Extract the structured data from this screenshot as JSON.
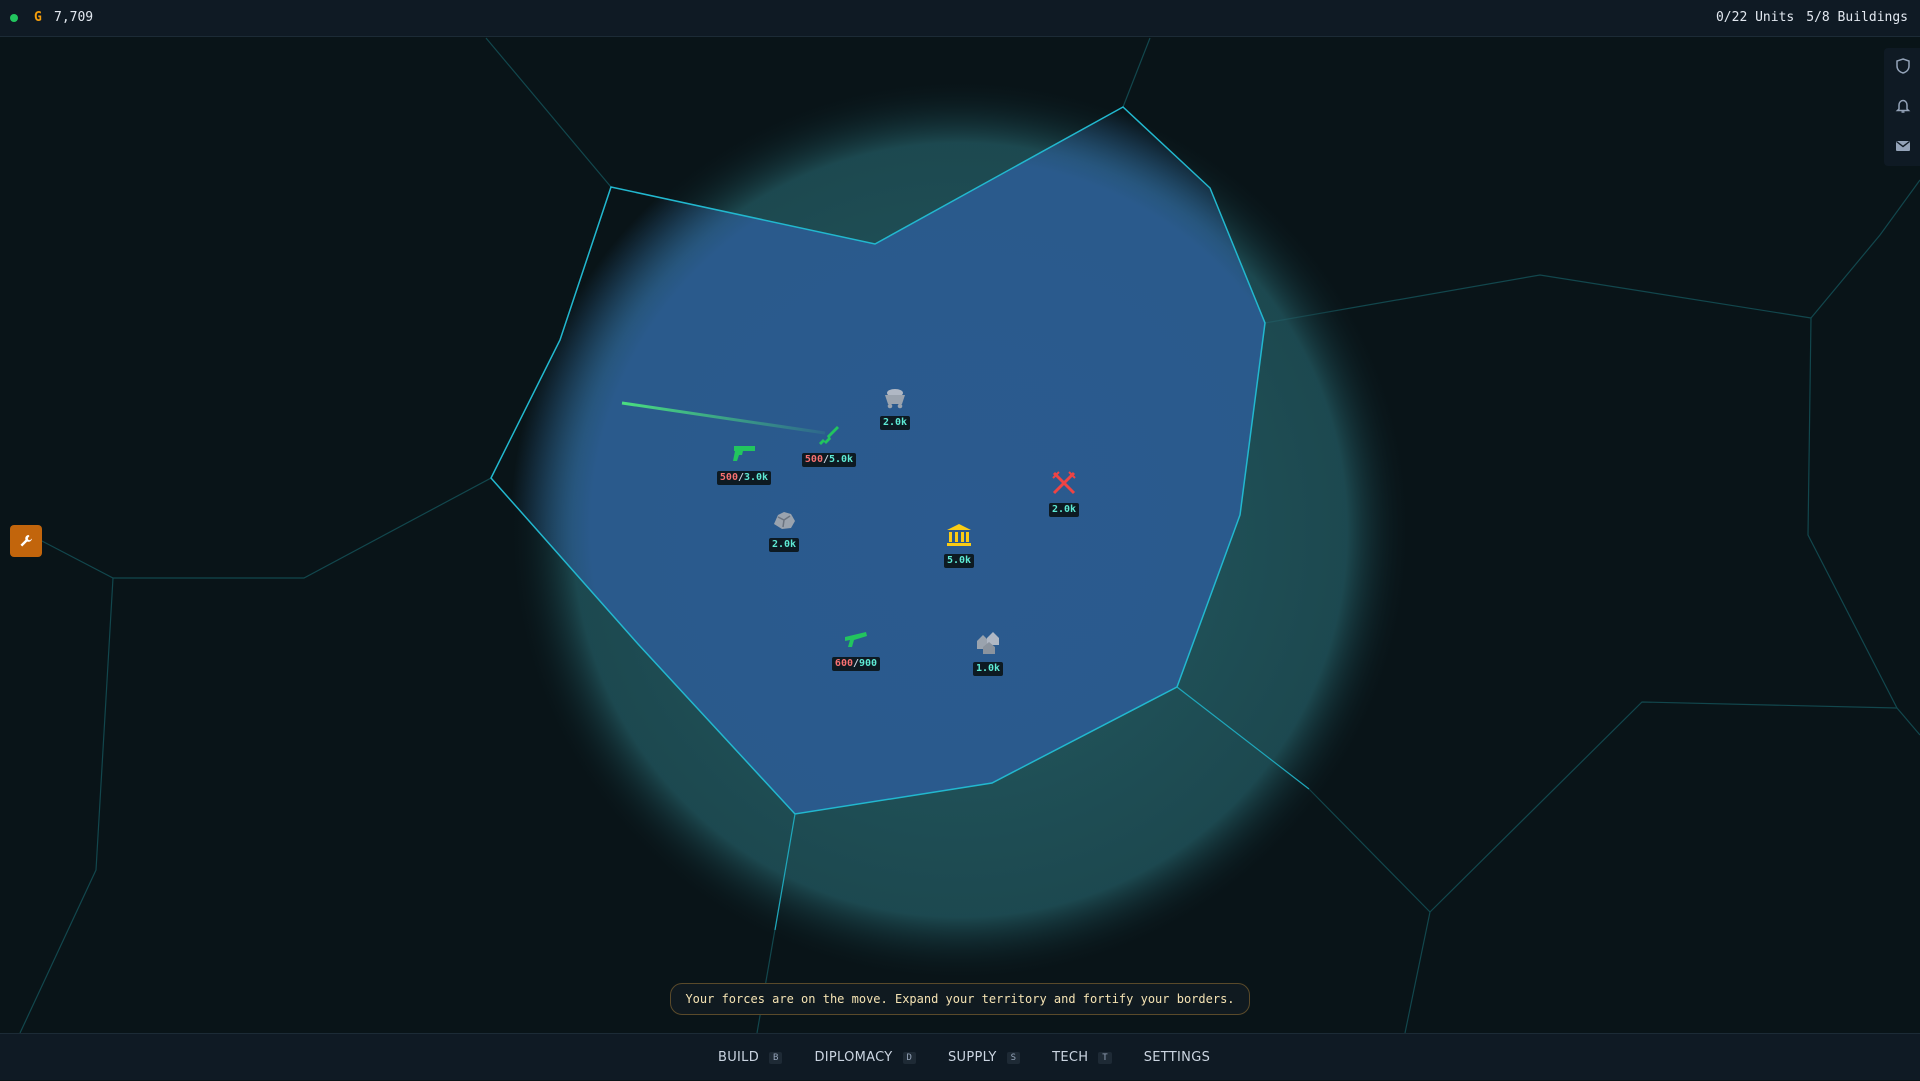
{
  "topbar": {
    "gold_icon": "G",
    "gold": "7,709",
    "units": "0/22 Units",
    "buildings": "5/8 Buildings"
  },
  "sidebar": {
    "icons": [
      "shield-icon",
      "bell-icon",
      "mail-icon"
    ]
  },
  "tool_button": {
    "icon": "wrench-icon"
  },
  "markers": [
    {
      "icon": "mine-cart-icon",
      "label": "2.0k"
    },
    {
      "icon": "rifle-icon",
      "label_current": "500",
      "label_max": "5.0k"
    },
    {
      "icon": "pistol-icon",
      "label_current": "500",
      "label_max": "3.0k"
    },
    {
      "icon": "ore-icon",
      "label": "2.0k"
    },
    {
      "icon": "bank-icon",
      "label": "5.0k"
    },
    {
      "icon": "crossed-swords-icon",
      "label": "2.0k"
    },
    {
      "icon": "artillery-icon",
      "label_current": "600",
      "label_max": "900"
    },
    {
      "icon": "houses-icon",
      "label": "1.0k"
    }
  ],
  "message": "Your forces are on the move. Expand your territory and fortify your borders.",
  "nav": [
    {
      "label": "BUILD",
      "key": "B"
    },
    {
      "label": "DIPLOMACY",
      "key": "D"
    },
    {
      "label": "SUPPLY",
      "key": "S"
    },
    {
      "label": "TECH",
      "key": "T"
    },
    {
      "label": "SETTINGS",
      "key": ""
    }
  ],
  "colors": {
    "background": "#091418",
    "territory": "#2b5a8f",
    "border": "#22b8cf",
    "accent": "#c2650c",
    "gold": "#f59e0b"
  }
}
